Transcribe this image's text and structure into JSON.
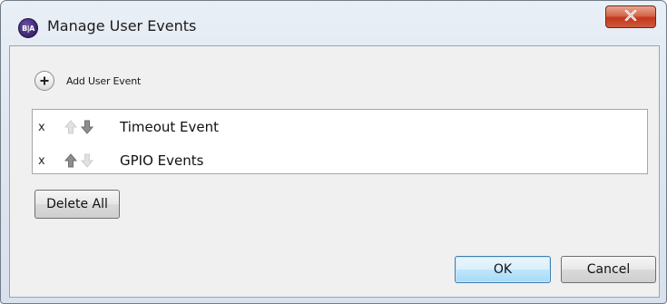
{
  "window": {
    "title": "Manage User Events",
    "app_icon_text": "B|A",
    "close_glyph": "X",
    "accent": "#c3371b"
  },
  "toolbar": {
    "add_icon": "plus-circle-icon",
    "add_label": "Add User Event"
  },
  "events": [
    {
      "remove": "x",
      "name": "Timeout Event",
      "can_move_up": false,
      "can_move_down": true
    },
    {
      "remove": "x",
      "name": "GPIO Events",
      "can_move_up": true,
      "can_move_down": false
    }
  ],
  "buttons": {
    "delete_all": "Delete All",
    "ok": "OK",
    "cancel": "Cancel"
  }
}
